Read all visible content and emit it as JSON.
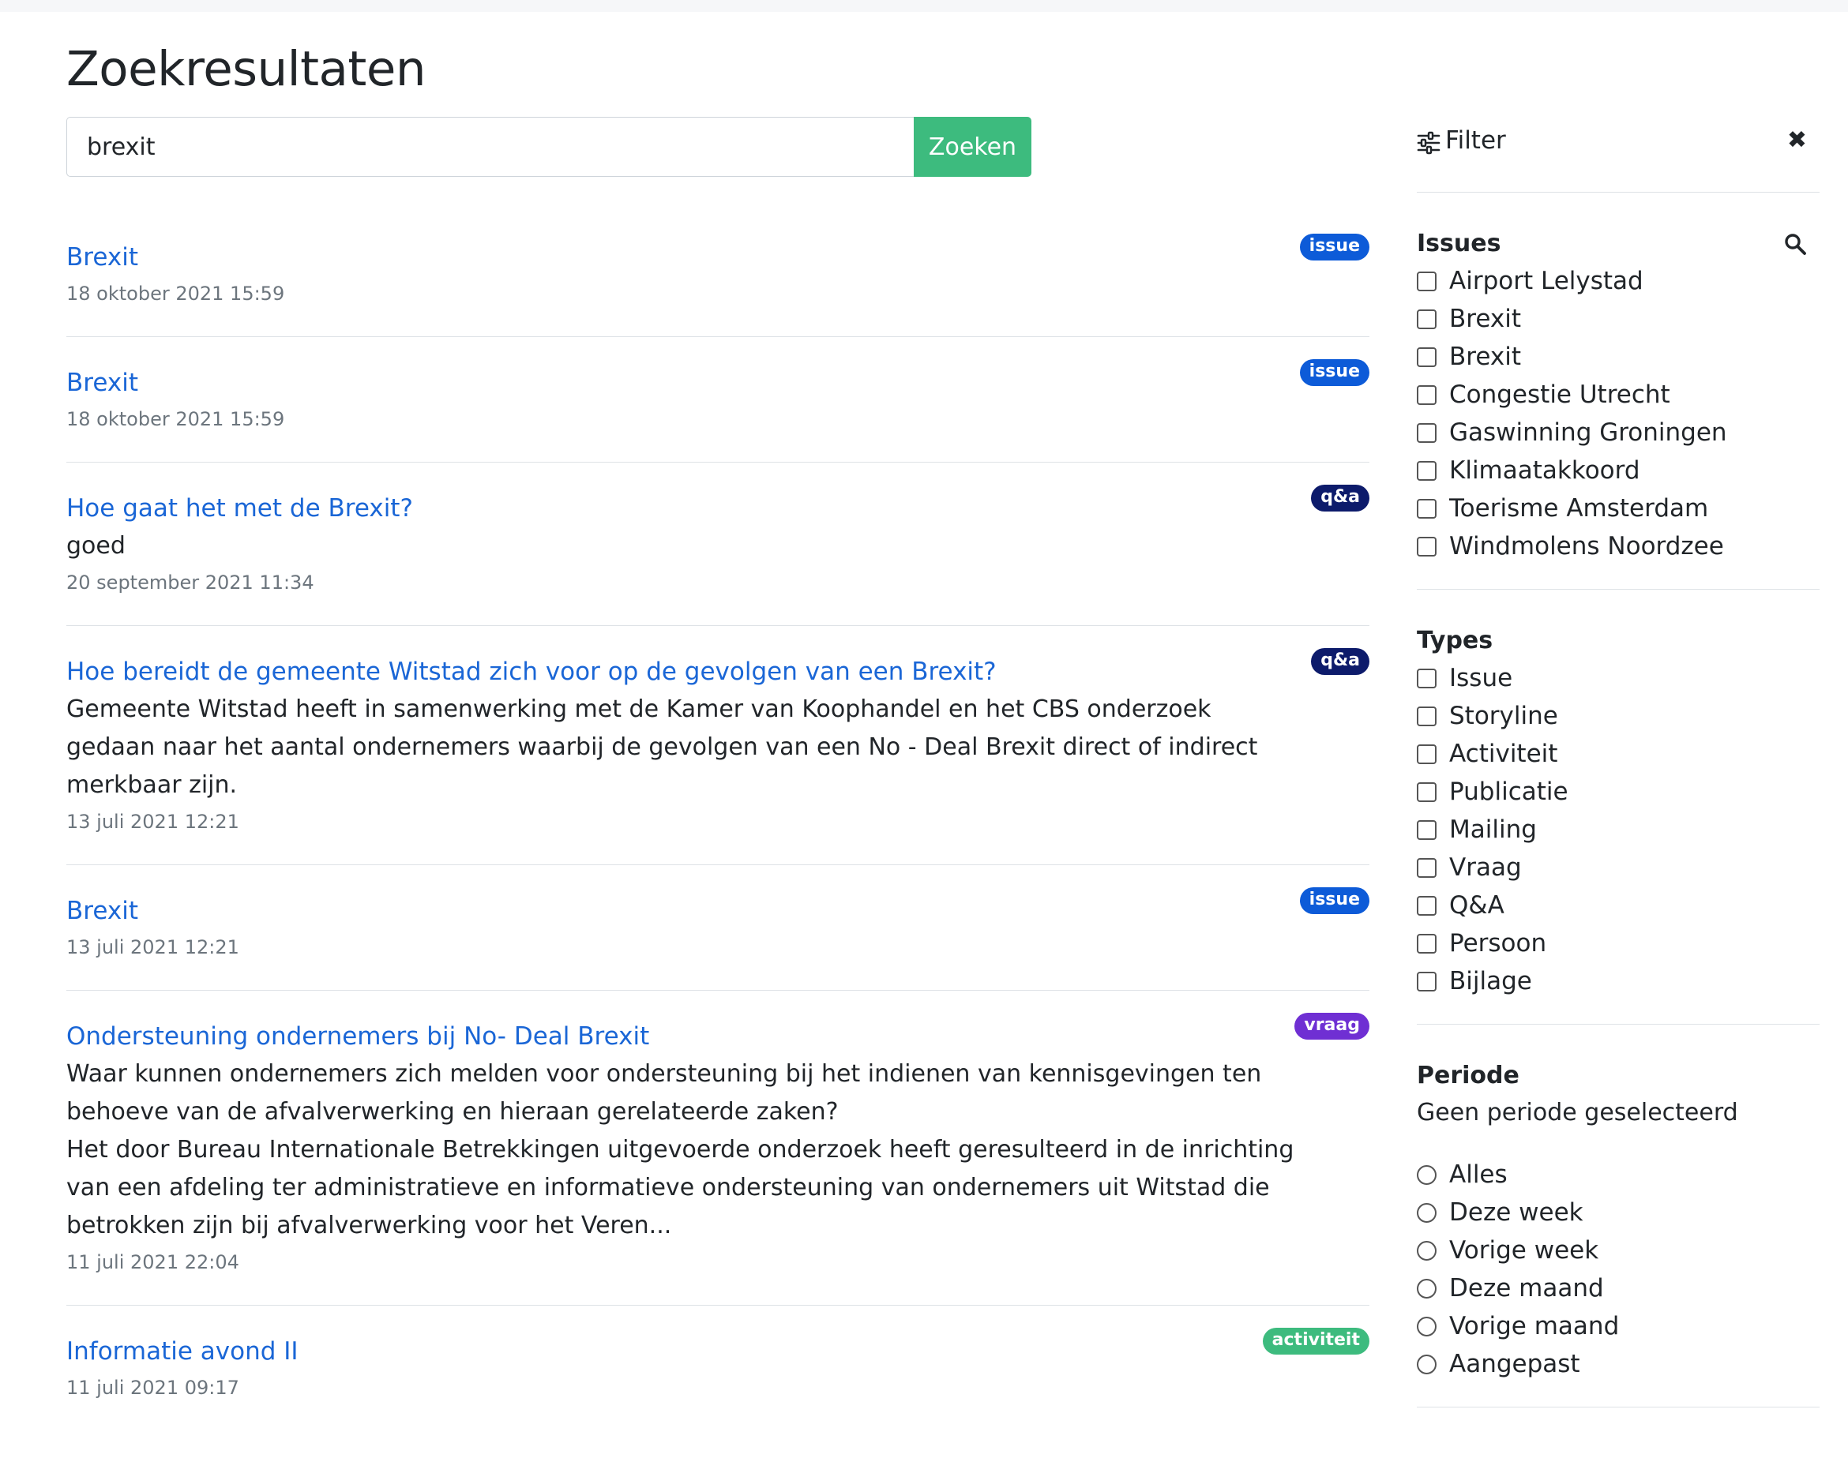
{
  "page": {
    "title": "Zoekresultaten"
  },
  "search": {
    "value": "brexit",
    "button_label": "Zoeken"
  },
  "results": [
    {
      "title": "Brexit",
      "date": "18 oktober 2021 15:59",
      "badge": "issue",
      "badge_color": "#0d5bd8",
      "body": []
    },
    {
      "title": "Brexit",
      "date": "18 oktober 2021 15:59",
      "badge": "issue",
      "badge_color": "#0d5bd8",
      "body": []
    },
    {
      "title": "Hoe gaat het met de Brexit?",
      "date": "20 september 2021 11:34",
      "badge": "q&a",
      "badge_color": "#0d1b6b",
      "body": [
        "goed"
      ]
    },
    {
      "title": "Hoe bereidt de gemeente Witstad zich voor op de gevolgen van een Brexit?",
      "date": "13 juli 2021 12:21",
      "badge": "q&a",
      "badge_color": "#0d1b6b",
      "body": [
        "Gemeente Witstad heeft in samenwerking met de Kamer van Koophandel en het CBS onderzoek gedaan naar het aantal ondernemers waarbij de gevolgen van een No - Deal Brexit direct of indirect merkbaar zijn."
      ]
    },
    {
      "title": "Brexit",
      "date": "13 juli 2021 12:21",
      "badge": "issue",
      "badge_color": "#0d5bd8",
      "body": []
    },
    {
      "title": "Ondersteuning ondernemers bij No- Deal Brexit",
      "date": "11 juli 2021 22:04",
      "badge": "vraag",
      "badge_color": "#6f2fd3",
      "body": [
        "Waar kunnen ondernemers zich melden voor ondersteuning bij het indienen van kennisgevingen ten behoeve van de afvalverwerking en hieraan gerelateerde zaken?",
        "Het door Bureau Internationale Betrekkingen uitgevoerde onderzoek heeft geresulteerd in de inrichting van een afdeling ter administratieve en informatieve ondersteuning van ondernemers uit Witstad die betrokken zijn bij afvalverwerking voor het Veren..."
      ]
    },
    {
      "title": "Informatie avond II",
      "date": "11 juli 2021 09:17",
      "badge": "activiteit",
      "badge_color": "#3dbb7e",
      "body": []
    }
  ],
  "filter": {
    "label": "Filter",
    "issues": {
      "title": "Issues",
      "options": [
        "Airport Lelystad",
        "Brexit",
        "Brexit",
        "Congestie Utrecht",
        "Gaswinning Groningen",
        "Klimaatakkoord",
        "Toerisme Amsterdam",
        "Windmolens Noordzee"
      ]
    },
    "types": {
      "title": "Types",
      "options": [
        "Issue",
        "Storyline",
        "Activiteit",
        "Publicatie",
        "Mailing",
        "Vraag",
        "Q&A",
        "Persoon",
        "Bijlage"
      ]
    },
    "periode": {
      "title": "Periode",
      "status": "Geen periode geselecteerd",
      "options": [
        "Alles",
        "Deze week",
        "Vorige week",
        "Deze maand",
        "Vorige maand",
        "Aangepast"
      ]
    }
  }
}
